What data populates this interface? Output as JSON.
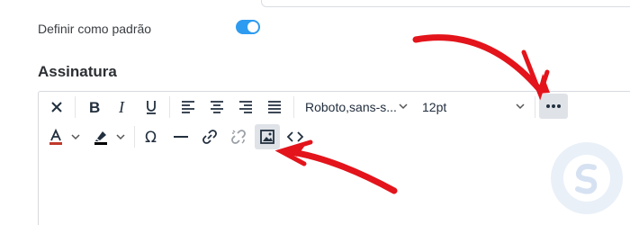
{
  "settings": {
    "default_label": "Definir como padrão",
    "default_enabled": true,
    "toggle_color": "#2d9bf0"
  },
  "signature": {
    "title": "Assinatura"
  },
  "toolbar": {
    "font_family": "Roboto,sans-s...",
    "font_size": "12pt",
    "buttons_row1": [
      {
        "name": "clear-formatting-icon",
        "glyph": "✕"
      },
      {
        "name": "bold-icon",
        "glyph": "B"
      },
      {
        "name": "italic-icon",
        "glyph": "I"
      },
      {
        "name": "underline-icon",
        "glyph": "U"
      },
      {
        "name": "align-left-icon"
      },
      {
        "name": "align-center-icon"
      },
      {
        "name": "align-right-icon"
      },
      {
        "name": "align-justify-icon"
      },
      {
        "name": "more-icon",
        "glyph": "•••"
      }
    ],
    "buttons_row2": [
      {
        "name": "text-color-icon",
        "glyph": "A"
      },
      {
        "name": "highlight-color-icon"
      },
      {
        "name": "special-character-icon",
        "glyph": "Ω"
      },
      {
        "name": "horizontal-line-icon"
      },
      {
        "name": "link-icon"
      },
      {
        "name": "unlink-icon"
      },
      {
        "name": "image-icon"
      },
      {
        "name": "source-code-icon",
        "glyph": "<>"
      }
    ],
    "text_color": "#c0392b",
    "highlight_color": "#000000"
  },
  "annotations": {
    "arrow_color": "#e3141b"
  }
}
